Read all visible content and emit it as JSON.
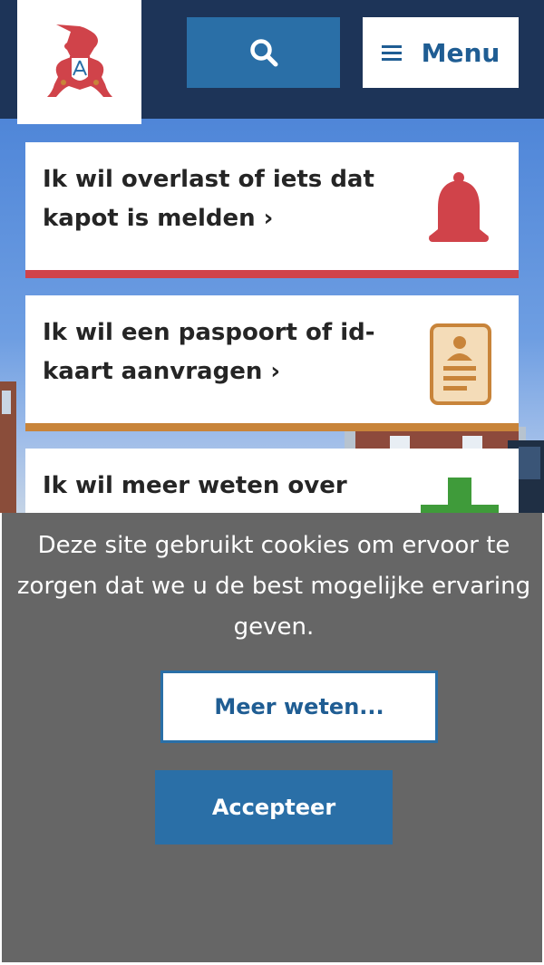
{
  "header": {
    "logo_alt": "municipal-coat-of-arms",
    "search_icon": "search-icon",
    "menu_icon": "hamburger-icon",
    "menu_label": "Menu"
  },
  "cards": [
    {
      "label": "Ik wil overlast of iets dat kapot is melden",
      "icon": "bell-icon",
      "accent": "#d0434a"
    },
    {
      "label": "Ik wil een paspoort of id-kaart aanvragen",
      "icon": "id-card-icon",
      "accent": "#c8843a"
    },
    {
      "label": "Ik wil meer weten over zorg",
      "icon": "plus-icon",
      "accent": "#3f9b3a"
    }
  ],
  "cookie": {
    "message": "Deze site gebruikt cookies om ervoor te zorgen dat we u de best mogelijke ervaring geven.",
    "more_label": "Meer weten...",
    "accept_label": "Accepteer"
  },
  "colors": {
    "header_bg": "#1d3458",
    "primary": "#2a6fa7",
    "cookie_bg": "#666666"
  }
}
